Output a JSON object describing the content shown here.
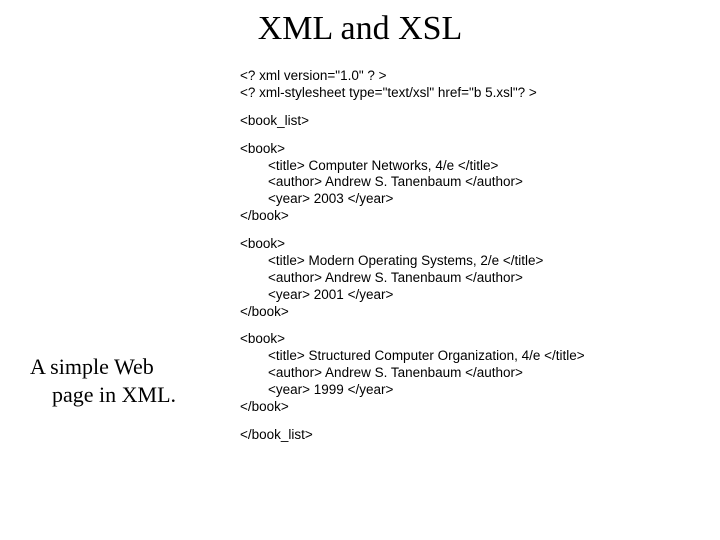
{
  "title": "XML and XSL",
  "caption": {
    "line1": "A simple Web",
    "line2": "page in XML."
  },
  "xml": {
    "decl1": "<? xml version=\"1.0\" ? >",
    "decl2": "<? xml-stylesheet type=\"text/xsl\" href=\"b 5.xsl\"? >",
    "booklist_open": "<book_list>",
    "book1": {
      "open": "<book>",
      "title": "<title> Computer Networks, 4/e </title>",
      "author": "<author> Andrew S. Tanenbaum </author>",
      "year": "<year> 2003 </year>",
      "close": "</book>"
    },
    "book2": {
      "open": "<book>",
      "title": "<title> Modern Operating Systems, 2/e </title>",
      "author": "<author> Andrew S. Tanenbaum </author>",
      "year": "<year> 2001 </year>",
      "close": "</book>"
    },
    "book3": {
      "open": "<book>",
      "title": "<title> Structured Computer Organization, 4/e </title>",
      "author": "<author> Andrew S. Tanenbaum </author>",
      "year": "<year> 1999 </year>",
      "close": "</book>"
    },
    "booklist_close": "</book_list>"
  }
}
